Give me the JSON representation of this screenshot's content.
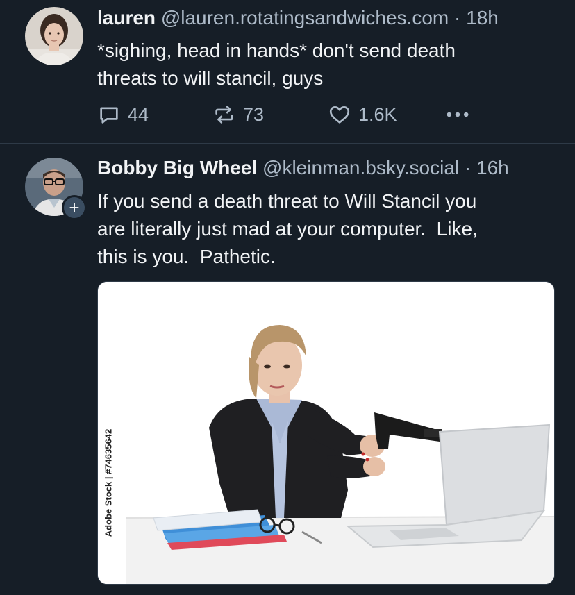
{
  "posts": [
    {
      "display_name": "lauren",
      "handle": "@lauren.rotatingsandwiches.com",
      "separator": "·",
      "time": "18h",
      "text_lines": [
        "*sighing, head in hands* don't send death",
        "threats to will stancil, guys"
      ],
      "replies": "44",
      "reposts": "73",
      "likes": "1.6K"
    },
    {
      "display_name": "Bobby Big Wheel",
      "handle": "@kleinman.bsky.social",
      "separator": "·",
      "time": "16h",
      "text_lines": [
        "If you send a death threat to Will Stancil you",
        "are literally just mad at your computer.  Like,",
        "this is you.  Pathetic."
      ],
      "follow_glyph": "+",
      "image_credit": "Adobe Stock | #74635642"
    }
  ],
  "icons": {
    "reply": "speech-bubble-icon",
    "repost": "repost-arrows-icon",
    "like": "heart-icon",
    "more": "ellipsis-icon"
  },
  "colors": {
    "background": "#161e27",
    "text": "#f1f3f5",
    "muted": "#aebbc9",
    "divider": "#2e3a47",
    "follow_badge": "#3a4d61"
  }
}
